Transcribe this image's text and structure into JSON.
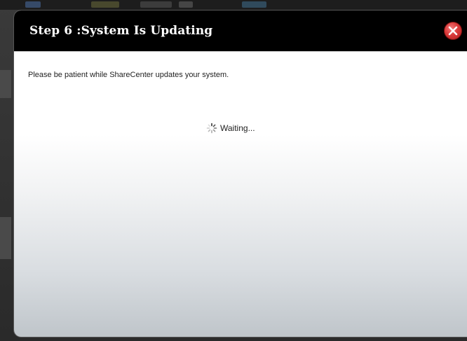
{
  "dialog": {
    "title": "Step 6 :System Is Updating",
    "message": "Please be patient while ShareCenter updates your system.",
    "status_text": "Waiting...",
    "close_icon": "close-icon",
    "spinner_icon": "spinner-icon"
  },
  "colors": {
    "header_bg": "#000000",
    "title_text": "#ffffff",
    "close_button": "#d93b3b",
    "body_text": "#222222"
  }
}
